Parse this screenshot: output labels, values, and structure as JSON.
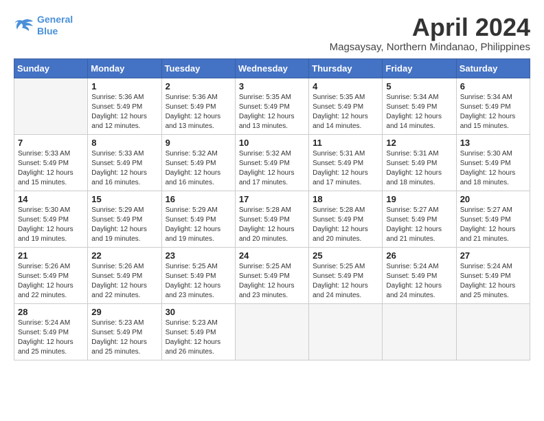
{
  "header": {
    "logo_line1": "General",
    "logo_line2": "Blue",
    "month": "April 2024",
    "location": "Magsaysay, Northern Mindanao, Philippines"
  },
  "days_of_week": [
    "Sunday",
    "Monday",
    "Tuesday",
    "Wednesday",
    "Thursday",
    "Friday",
    "Saturday"
  ],
  "weeks": [
    [
      {
        "day": "",
        "info": ""
      },
      {
        "day": "1",
        "info": "Sunrise: 5:36 AM\nSunset: 5:49 PM\nDaylight: 12 hours\nand 12 minutes."
      },
      {
        "day": "2",
        "info": "Sunrise: 5:36 AM\nSunset: 5:49 PM\nDaylight: 12 hours\nand 13 minutes."
      },
      {
        "day": "3",
        "info": "Sunrise: 5:35 AM\nSunset: 5:49 PM\nDaylight: 12 hours\nand 13 minutes."
      },
      {
        "day": "4",
        "info": "Sunrise: 5:35 AM\nSunset: 5:49 PM\nDaylight: 12 hours\nand 14 minutes."
      },
      {
        "day": "5",
        "info": "Sunrise: 5:34 AM\nSunset: 5:49 PM\nDaylight: 12 hours\nand 14 minutes."
      },
      {
        "day": "6",
        "info": "Sunrise: 5:34 AM\nSunset: 5:49 PM\nDaylight: 12 hours\nand 15 minutes."
      }
    ],
    [
      {
        "day": "7",
        "info": "Sunrise: 5:33 AM\nSunset: 5:49 PM\nDaylight: 12 hours\nand 15 minutes."
      },
      {
        "day": "8",
        "info": "Sunrise: 5:33 AM\nSunset: 5:49 PM\nDaylight: 12 hours\nand 16 minutes."
      },
      {
        "day": "9",
        "info": "Sunrise: 5:32 AM\nSunset: 5:49 PM\nDaylight: 12 hours\nand 16 minutes."
      },
      {
        "day": "10",
        "info": "Sunrise: 5:32 AM\nSunset: 5:49 PM\nDaylight: 12 hours\nand 17 minutes."
      },
      {
        "day": "11",
        "info": "Sunrise: 5:31 AM\nSunset: 5:49 PM\nDaylight: 12 hours\nand 17 minutes."
      },
      {
        "day": "12",
        "info": "Sunrise: 5:31 AM\nSunset: 5:49 PM\nDaylight: 12 hours\nand 18 minutes."
      },
      {
        "day": "13",
        "info": "Sunrise: 5:30 AM\nSunset: 5:49 PM\nDaylight: 12 hours\nand 18 minutes."
      }
    ],
    [
      {
        "day": "14",
        "info": "Sunrise: 5:30 AM\nSunset: 5:49 PM\nDaylight: 12 hours\nand 19 minutes."
      },
      {
        "day": "15",
        "info": "Sunrise: 5:29 AM\nSunset: 5:49 PM\nDaylight: 12 hours\nand 19 minutes."
      },
      {
        "day": "16",
        "info": "Sunrise: 5:29 AM\nSunset: 5:49 PM\nDaylight: 12 hours\nand 19 minutes."
      },
      {
        "day": "17",
        "info": "Sunrise: 5:28 AM\nSunset: 5:49 PM\nDaylight: 12 hours\nand 20 minutes."
      },
      {
        "day": "18",
        "info": "Sunrise: 5:28 AM\nSunset: 5:49 PM\nDaylight: 12 hours\nand 20 minutes."
      },
      {
        "day": "19",
        "info": "Sunrise: 5:27 AM\nSunset: 5:49 PM\nDaylight: 12 hours\nand 21 minutes."
      },
      {
        "day": "20",
        "info": "Sunrise: 5:27 AM\nSunset: 5:49 PM\nDaylight: 12 hours\nand 21 minutes."
      }
    ],
    [
      {
        "day": "21",
        "info": "Sunrise: 5:26 AM\nSunset: 5:49 PM\nDaylight: 12 hours\nand 22 minutes."
      },
      {
        "day": "22",
        "info": "Sunrise: 5:26 AM\nSunset: 5:49 PM\nDaylight: 12 hours\nand 22 minutes."
      },
      {
        "day": "23",
        "info": "Sunrise: 5:25 AM\nSunset: 5:49 PM\nDaylight: 12 hours\nand 23 minutes."
      },
      {
        "day": "24",
        "info": "Sunrise: 5:25 AM\nSunset: 5:49 PM\nDaylight: 12 hours\nand 23 minutes."
      },
      {
        "day": "25",
        "info": "Sunrise: 5:25 AM\nSunset: 5:49 PM\nDaylight: 12 hours\nand 24 minutes."
      },
      {
        "day": "26",
        "info": "Sunrise: 5:24 AM\nSunset: 5:49 PM\nDaylight: 12 hours\nand 24 minutes."
      },
      {
        "day": "27",
        "info": "Sunrise: 5:24 AM\nSunset: 5:49 PM\nDaylight: 12 hours\nand 25 minutes."
      }
    ],
    [
      {
        "day": "28",
        "info": "Sunrise: 5:24 AM\nSunset: 5:49 PM\nDaylight: 12 hours\nand 25 minutes."
      },
      {
        "day": "29",
        "info": "Sunrise: 5:23 AM\nSunset: 5:49 PM\nDaylight: 12 hours\nand 25 minutes."
      },
      {
        "day": "30",
        "info": "Sunrise: 5:23 AM\nSunset: 5:49 PM\nDaylight: 12 hours\nand 26 minutes."
      },
      {
        "day": "",
        "info": ""
      },
      {
        "day": "",
        "info": ""
      },
      {
        "day": "",
        "info": ""
      },
      {
        "day": "",
        "info": ""
      }
    ]
  ]
}
